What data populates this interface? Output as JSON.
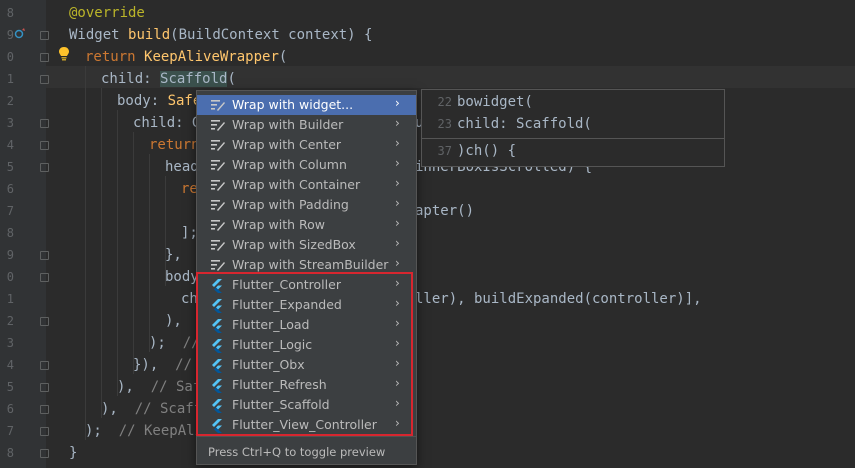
{
  "gutter": {
    "line_numbers": [
      "8",
      "9",
      "0",
      "1",
      "2",
      "3",
      "4",
      "5",
      "6",
      "7",
      "8",
      "9",
      "0",
      "1",
      "2",
      "3",
      "4",
      "5",
      "6",
      "7",
      "8"
    ]
  },
  "code_lines": [
    {
      "indent": 0,
      "parts": [
        {
          "t": "@override",
          "c": "an"
        }
      ]
    },
    {
      "indent": 0,
      "parts": [
        {
          "t": "Widget "
        },
        {
          "t": "build",
          "c": "fn"
        },
        {
          "t": "(BuildContext context) {"
        }
      ]
    },
    {
      "indent": 1,
      "parts": [
        {
          "t": "return ",
          "c": "kw"
        },
        {
          "t": "KeepAliveWrapper",
          "c": "fn"
        },
        {
          "t": "("
        }
      ]
    },
    {
      "indent": 2,
      "parts": [
        {
          "t": "child: "
        },
        {
          "t": "Scaffold",
          "c": "hl"
        },
        {
          "t": "("
        }
      ]
    },
    {
      "indent": 3,
      "parts": [
        {
          "t": "body: "
        },
        {
          "t": "Safe",
          "c": "fn"
        }
      ]
    },
    {
      "indent": 4,
      "parts": [
        {
          "t": "child: G"
        }
      ]
    },
    {
      "indent": 5,
      "parts": [
        {
          "t": "return",
          "c": "kw"
        }
      ]
    },
    {
      "indent": 6,
      "parts": [
        {
          "t": "head"
        }
      ]
    },
    {
      "indent": 7,
      "parts": [
        {
          "t": "re",
          "c": "kw"
        }
      ]
    },
    {
      "indent": 7,
      "parts": [
        {
          "t": ""
        }
      ]
    },
    {
      "indent": 7,
      "parts": [
        {
          "t": "];"
        }
      ]
    },
    {
      "indent": 6,
      "parts": [
        {
          "t": "},"
        }
      ]
    },
    {
      "indent": 6,
      "parts": [
        {
          "t": "body"
        }
      ]
    },
    {
      "indent": 7,
      "parts": [
        {
          "t": "ch"
        }
      ]
    },
    {
      "indent": 6,
      "parts": [
        {
          "t": "),"
        }
      ]
    },
    {
      "indent": 5,
      "parts": [
        {
          "t": ");  "
        },
        {
          "t": "//",
          "c": "cm"
        }
      ]
    },
    {
      "indent": 4,
      "parts": [
        {
          "t": "}),  "
        },
        {
          "t": "//",
          "c": "cm"
        }
      ]
    },
    {
      "indent": 3,
      "parts": [
        {
          "t": "),  "
        },
        {
          "t": "// Saf",
          "c": "cm"
        }
      ]
    },
    {
      "indent": 2,
      "parts": [
        {
          "t": "),  "
        },
        {
          "t": "// Scaff",
          "c": "cm"
        }
      ]
    },
    {
      "indent": 1,
      "parts": [
        {
          "t": ");  "
        },
        {
          "t": "// KeepAli",
          "c": "cm"
        }
      ]
    },
    {
      "indent": 0,
      "parts": [
        {
          "t": "}"
        }
      ]
    }
  ],
  "right_fragments": [
    {
      "text": "u",
      "line": 5
    },
    {
      "text": "innerBoxIsScrolled) {",
      "line": 7
    },
    {
      "text": "apter()",
      "line": 9
    },
    {
      "text": "ller), buildExpanded(controller)],",
      "line": 13
    }
  ],
  "menu": {
    "items": [
      {
        "label": "Wrap with widget...",
        "icon": "wrap-icon",
        "selected": true
      },
      {
        "label": "Wrap with Builder",
        "icon": "wrap-icon"
      },
      {
        "label": "Wrap with Center",
        "icon": "wrap-icon"
      },
      {
        "label": "Wrap with Column",
        "icon": "wrap-icon"
      },
      {
        "label": "Wrap with Container",
        "icon": "wrap-icon"
      },
      {
        "label": "Wrap with Padding",
        "icon": "wrap-icon"
      },
      {
        "label": "Wrap with Row",
        "icon": "wrap-icon"
      },
      {
        "label": "Wrap with SizedBox",
        "icon": "wrap-icon"
      },
      {
        "label": "Wrap with StreamBuilder",
        "icon": "wrap-icon"
      },
      {
        "label": "Flutter_Controller",
        "icon": "flutter-icon"
      },
      {
        "label": "Flutter_Expanded",
        "icon": "flutter-icon"
      },
      {
        "label": "Flutter_Load",
        "icon": "flutter-icon"
      },
      {
        "label": "Flutter_Logic",
        "icon": "flutter-icon"
      },
      {
        "label": "Flutter_Obx",
        "icon": "flutter-icon"
      },
      {
        "label": "Flutter_Refresh",
        "icon": "flutter-icon"
      },
      {
        "label": "Flutter_Scaffold",
        "icon": "flutter-icon"
      },
      {
        "label": "Flutter_View_Controller",
        "icon": "flutter-icon"
      }
    ],
    "footer": "Press Ctrl+Q to toggle preview"
  },
  "preview": {
    "lines": [
      {
        "num": "22",
        "code": "bowidget("
      },
      {
        "num": "23",
        "code": "child: Scaffold("
      },
      {
        "num": "37",
        "code": ")ch() {"
      }
    ]
  },
  "colors": {
    "editor_bg": "#2b2b2b",
    "menu_bg": "#3c3f41",
    "selection": "#4b6eaf",
    "highlight_box": "#d7262f",
    "flutter_blue": "#42a5f5"
  }
}
